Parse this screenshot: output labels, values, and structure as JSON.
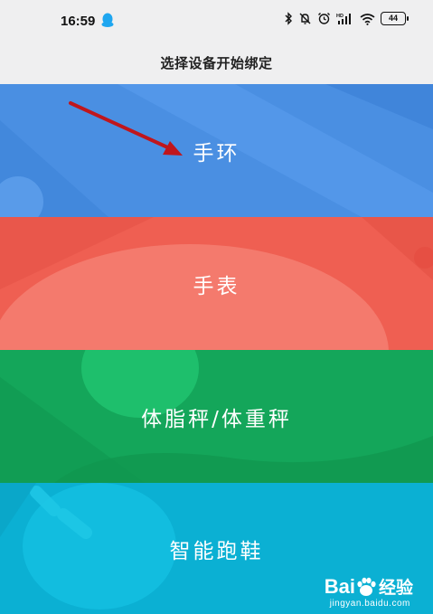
{
  "status_bar": {
    "time": "16:59",
    "battery": "44",
    "icons": [
      "qq-icon",
      "bluetooth-icon",
      "mute-icon",
      "alarm-icon",
      "hd-signal-icon",
      "wifi-icon",
      "battery-icon"
    ]
  },
  "header": {
    "title": "选择设备开始绑定"
  },
  "devices": [
    {
      "label": "手环",
      "color": "#4a8fe2"
    },
    {
      "label": "手表",
      "color": "#ef5f52"
    },
    {
      "label": "体脂秤/体重秤",
      "color": "#14a65a"
    },
    {
      "label": "智能跑鞋",
      "color": "#0bb0d3"
    }
  ],
  "annotation": {
    "arrow_color": "#c0161c"
  },
  "watermark": {
    "brand": "Bai",
    "brand_suffix": "经验",
    "url": "jingyan.baidu.com"
  }
}
